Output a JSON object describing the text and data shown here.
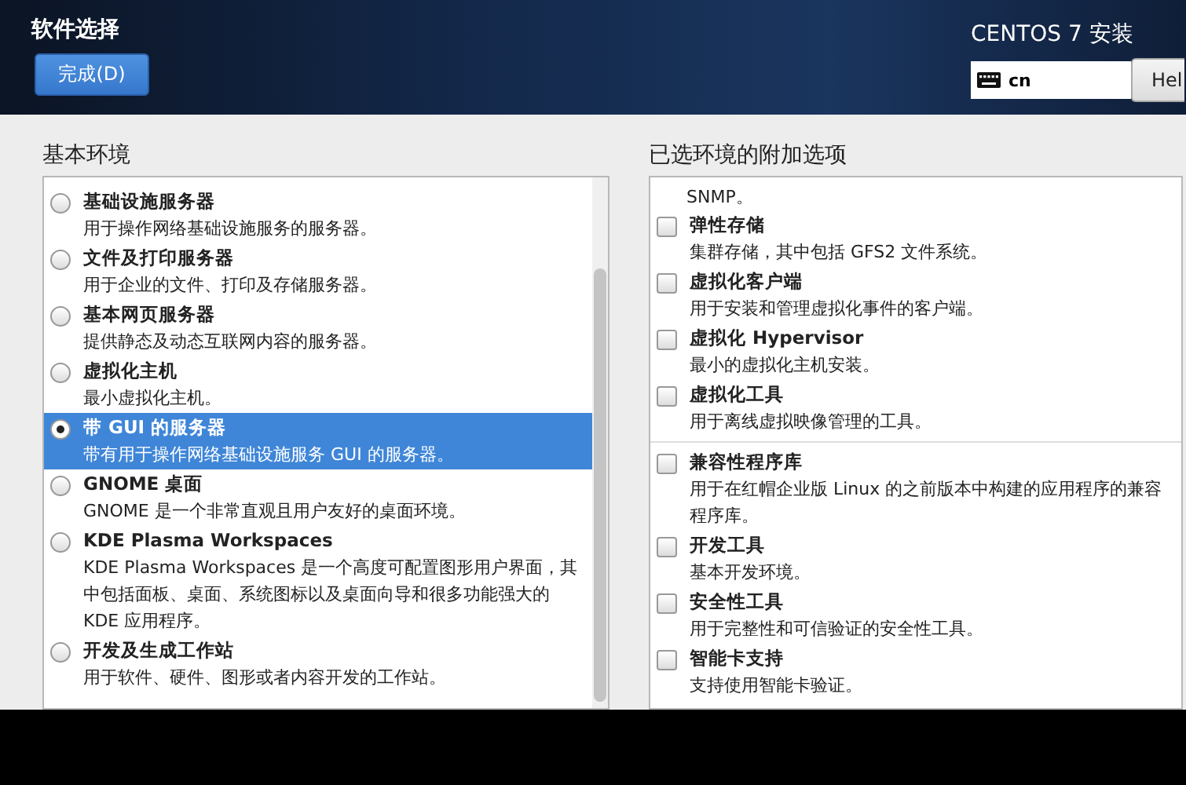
{
  "header": {
    "title": "软件选择",
    "done_button": "完成(D)",
    "product": "CENTOS 7 安装",
    "keyboard_layout": "cn",
    "help_button": "Hel"
  },
  "base_environment": {
    "heading": "基本环境",
    "items": [
      {
        "title": "基础设施服务器",
        "description": "用于操作网络基础设施服务的服务器。",
        "selected": false
      },
      {
        "title": "文件及打印服务器",
        "description": "用于企业的文件、打印及存储服务器。",
        "selected": false
      },
      {
        "title": "基本网页服务器",
        "description": "提供静态及动态互联网内容的服务器。",
        "selected": false
      },
      {
        "title": "虚拟化主机",
        "description": "最小虚拟化主机。",
        "selected": false
      },
      {
        "title": "带 GUI 的服务器",
        "description": "带有用于操作网络基础设施服务 GUI 的服务器。",
        "selected": true
      },
      {
        "title": "GNOME 桌面",
        "description": "GNOME 是一个非常直观且用户友好的桌面环境。",
        "selected": false
      },
      {
        "title": "KDE Plasma Workspaces",
        "description": "KDE Plasma Workspaces 是一个高度可配置图形用户界面，其中包括面板、桌面、系统图标以及桌面向导和很多功能强大的 KDE 应用程序。",
        "selected": false
      },
      {
        "title": "开发及生成工作站",
        "description": "用于软件、硬件、图形或者内容开发的工作站。",
        "selected": false
      }
    ]
  },
  "addons": {
    "heading": "已选环境的附加选项",
    "overflow_text": "SNMP。",
    "groups": [
      {
        "items": [
          {
            "title": "弹性存储",
            "description": "集群存储，其中包括 GFS2 文件系统。",
            "checked": false
          },
          {
            "title": "虚拟化客户端",
            "description": "用于安装和管理虚拟化事件的客户端。",
            "checked": false
          },
          {
            "title": "虚拟化 Hypervisor",
            "description": "最小的虚拟化主机安装。",
            "checked": false
          },
          {
            "title": "虚拟化工具",
            "description": "用于离线虚拟映像管理的工具。",
            "checked": false
          }
        ]
      },
      {
        "items": [
          {
            "title": "兼容性程序库",
            "description": "用于在红帽企业版 Linux 的之前版本中构建的应用程序的兼容程序库。",
            "checked": false
          },
          {
            "title": "开发工具",
            "description": "基本开发环境。",
            "checked": false
          },
          {
            "title": "安全性工具",
            "description": "用于完整性和可信验证的安全性工具。",
            "checked": false
          },
          {
            "title": "智能卡支持",
            "description": "支持使用智能卡验证。",
            "checked": false
          }
        ]
      }
    ]
  }
}
